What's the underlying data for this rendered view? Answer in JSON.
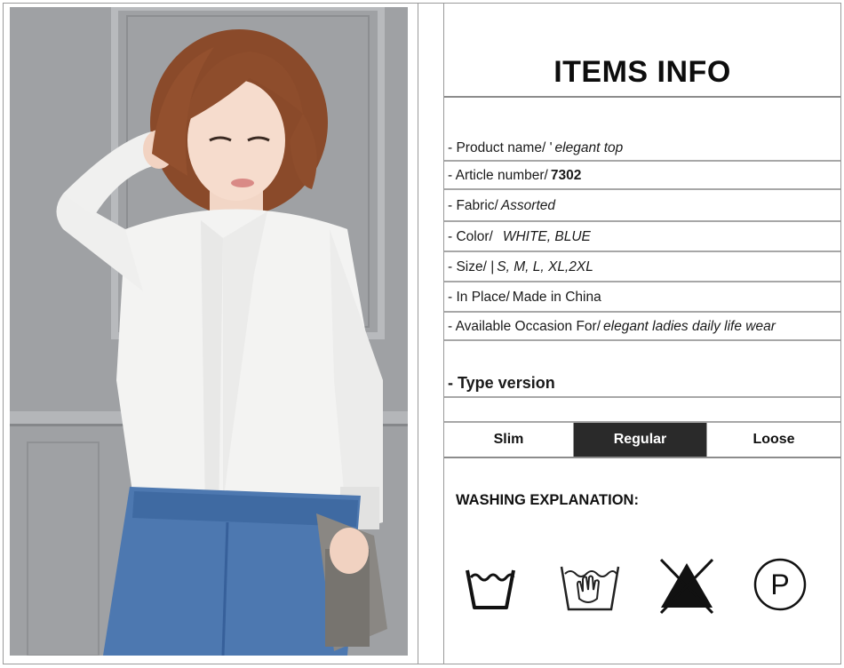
{
  "title": "ITEMS INFO",
  "rows": [
    {
      "label": "- Product name/ '",
      "value": "elegant top"
    },
    {
      "label": "- Article number/",
      "value": "7302"
    },
    {
      "label": "- Fabric/",
      "value": "Assorted"
    },
    {
      "label": "- Color/",
      "value": "WHITE, BLUE"
    },
    {
      "label": "- Size/ |",
      "value": "S, M, L, XL,2XL"
    },
    {
      "label": "- In Place/",
      "value": "Made in China"
    },
    {
      "label": "- Available Occasion For/",
      "value": "elegant ladies daily life wear"
    }
  ],
  "type_version": {
    "heading": "- Type version",
    "options": [
      "Slim",
      "Regular",
      "Loose"
    ],
    "selected": "Regular"
  },
  "washing": {
    "heading": "WASHING EXPLANATION:",
    "icons": [
      "wash-tub-icon",
      "hand-wash-icon",
      "no-bleach-icon",
      "dry-clean-p-icon"
    ],
    "p_letter": "P"
  },
  "colors": {
    "border": "#9a9a9a",
    "selected_bg": "#2a2a2a",
    "photo_wall": "#9ea0a3"
  }
}
